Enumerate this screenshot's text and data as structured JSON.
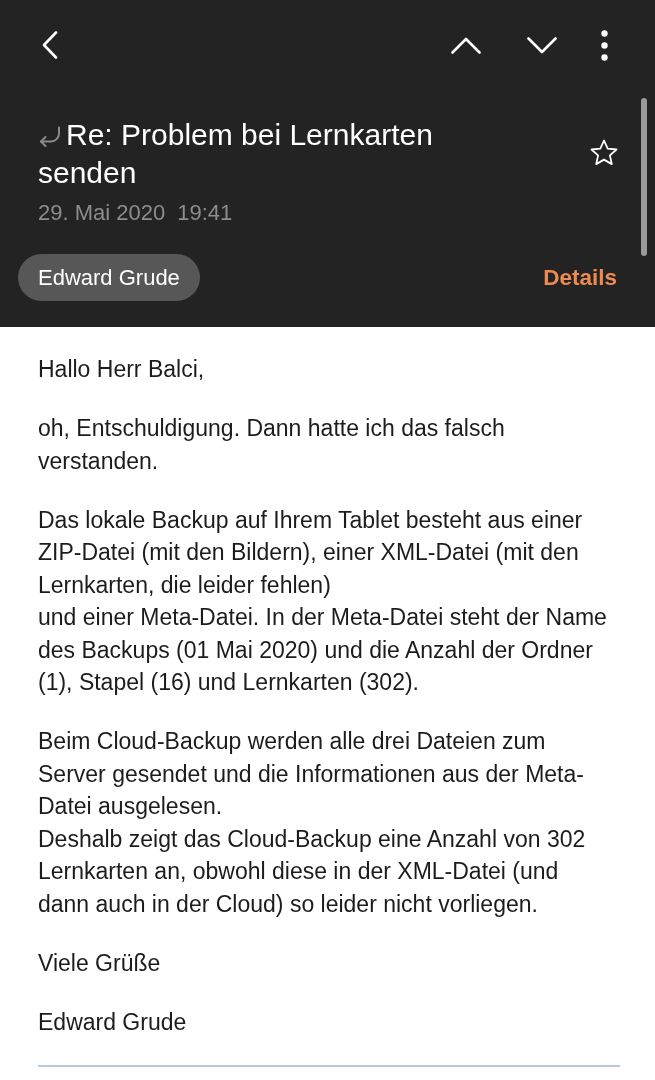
{
  "header": {
    "replied": true,
    "subject": "Re: Problem bei Lernkarten senden",
    "starred": false,
    "date": "29. Mai 2020",
    "time": "19:41",
    "sender": "Edward Grude",
    "details_link": "Details"
  },
  "body": {
    "paragraphs": [
      "Hallo Herr Balci,",
      "oh, Entschuldigung. Dann hatte ich das falsch verstanden.",
      "Das lokale Backup auf Ihrem Tablet besteht aus einer ZIP-Datei (mit den Bildern), einer XML-Datei (mit den Lernkarten, die leider fehlen)\nund einer Meta-Datei. In der Meta-Datei steht der Name des Backups (01 Mai 2020) und die Anzahl der Ordner (1), Stapel (16) und Lernkarten (302).",
      "Beim Cloud-Backup werden alle drei Dateien zum Server gesendet und die Informationen aus der Meta-Datei ausgelesen.\nDeshalb zeigt das Cloud-Backup eine Anzahl von 302 Lernkarten an, obwohl diese in der XML-Datei (und dann auch in der Cloud) so leider nicht vorliegen.",
      "Viele Grüße",
      "Edward Grude"
    ]
  }
}
